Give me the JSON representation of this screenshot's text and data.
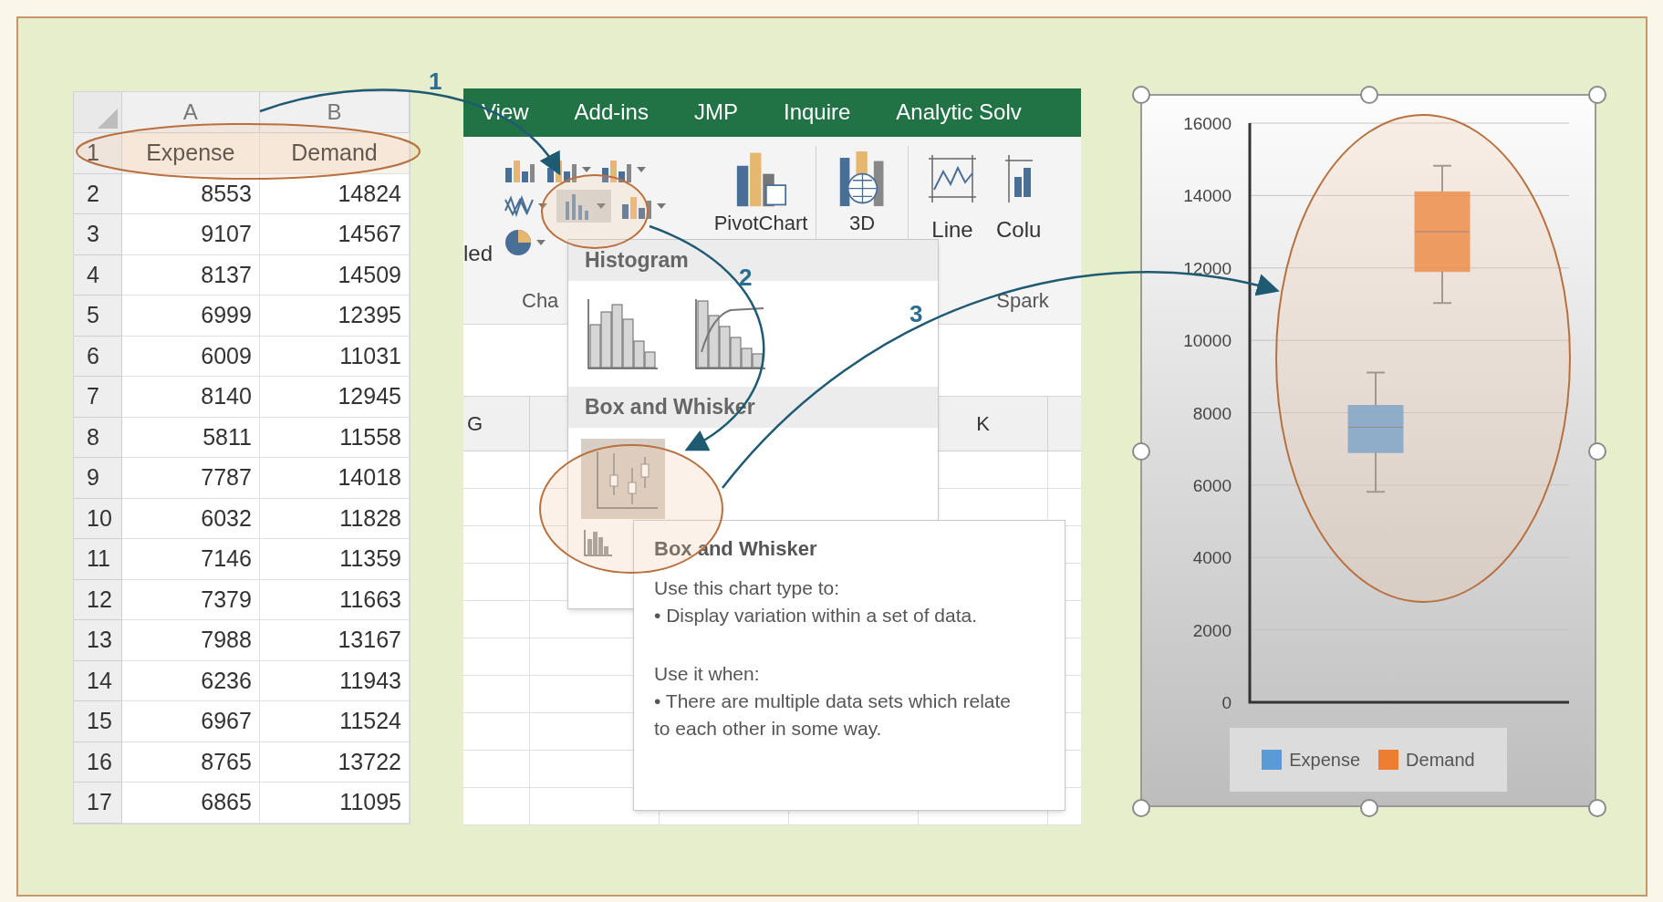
{
  "spreadsheet": {
    "columns": [
      "A",
      "B"
    ],
    "rows": [
      {
        "number": "1",
        "cells": [
          "Expense",
          "Demand"
        ]
      },
      {
        "number": "2",
        "cells": [
          "8553",
          "14824"
        ]
      },
      {
        "number": "3",
        "cells": [
          "9107",
          "14567"
        ]
      },
      {
        "number": "4",
        "cells": [
          "8137",
          "14509"
        ]
      },
      {
        "number": "5",
        "cells": [
          "6999",
          "12395"
        ]
      },
      {
        "number": "6",
        "cells": [
          "6009",
          "11031"
        ]
      },
      {
        "number": "7",
        "cells": [
          "8140",
          "12945"
        ]
      },
      {
        "number": "8",
        "cells": [
          "5811",
          "11558"
        ]
      },
      {
        "number": "9",
        "cells": [
          "7787",
          "14018"
        ]
      },
      {
        "number": "10",
        "cells": [
          "6032",
          "11828"
        ]
      },
      {
        "number": "11",
        "cells": [
          "7146",
          "11359"
        ]
      },
      {
        "number": "12",
        "cells": [
          "7379",
          "11663"
        ]
      },
      {
        "number": "13",
        "cells": [
          "7988",
          "13167"
        ]
      },
      {
        "number": "14",
        "cells": [
          "6236",
          "11943"
        ]
      },
      {
        "number": "15",
        "cells": [
          "6967",
          "11524"
        ]
      },
      {
        "number": "16",
        "cells": [
          "8765",
          "13722"
        ]
      },
      {
        "number": "17",
        "cells": [
          "6865",
          "11095"
        ]
      }
    ]
  },
  "ribbon": {
    "tabs": [
      "View",
      "Add-ins",
      "JMP",
      "Inquire",
      "Analytic Solv"
    ],
    "partial_label": "led",
    "statistic_button": {
      "selected": true
    },
    "pivotchart_label": "PivotChart",
    "map_label": "3D",
    "sparkline_buttons": [
      "Line",
      "Colu"
    ],
    "group_labels": [
      "Cha",
      "Spark"
    ]
  },
  "grid": {
    "column_headers": [
      "G",
      "K"
    ]
  },
  "dropdown": {
    "sections": [
      {
        "heading": "Histogram",
        "items": [
          {
            "kind": "histogram",
            "selected": false
          },
          {
            "kind": "pareto",
            "selected": false
          }
        ]
      },
      {
        "heading": "Box and Whisker",
        "items": [
          {
            "kind": "boxwhisker",
            "selected": true
          }
        ]
      }
    ]
  },
  "tooltip": {
    "title": "Box and Whisker",
    "sections": [
      {
        "heading": "Use this chart type to:",
        "bullet": "• Display variation within a set of data."
      },
      {
        "heading": "Use it when:",
        "bullet": "• There are multiple data sets which relate to each other in some way."
      }
    ]
  },
  "chart": {
    "yticks": [
      "16000",
      "14000",
      "12000",
      "10000",
      "8000",
      "6000",
      "4000",
      "2000",
      "0"
    ],
    "legend": [
      {
        "label": "Expense",
        "color": "#5b9bd5"
      },
      {
        "label": "Demand",
        "color": "#ed7d31"
      }
    ]
  },
  "callouts": [
    "1",
    "2",
    "3"
  ]
}
